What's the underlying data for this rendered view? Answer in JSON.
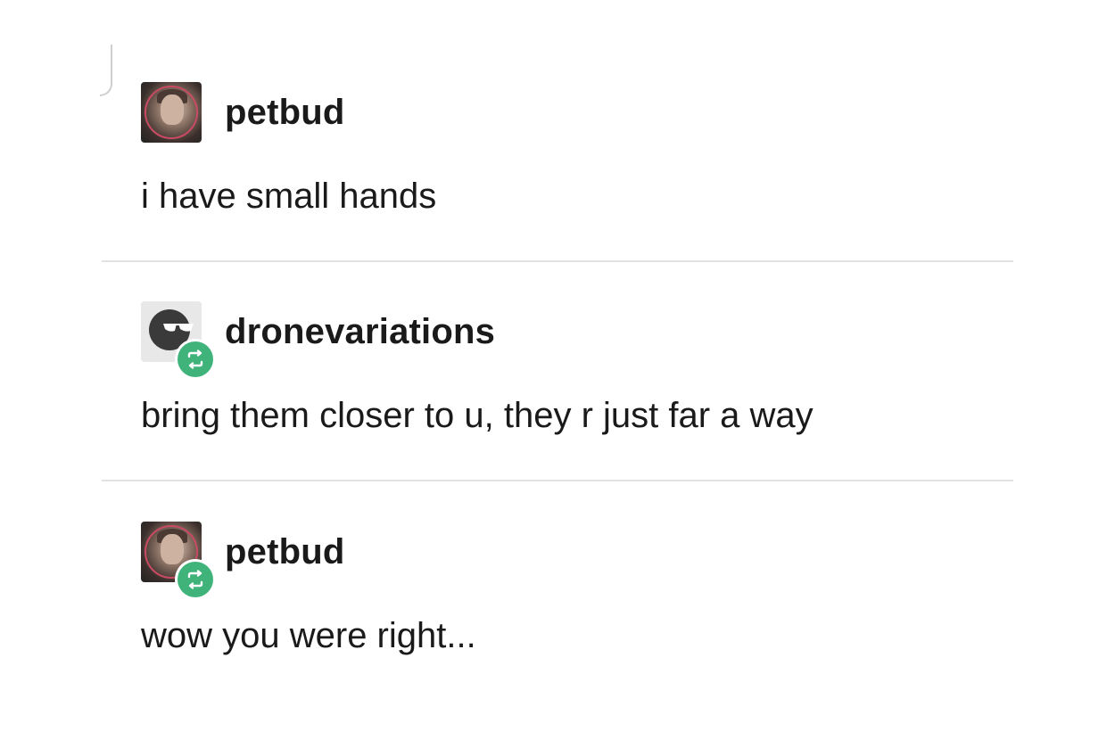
{
  "thread": {
    "posts": [
      {
        "username": "petbud",
        "avatar": "petbud-avatar",
        "reblog": false,
        "text": "i have small hands"
      },
      {
        "username": "dronevariations",
        "avatar": "dronevariations-avatar",
        "reblog": true,
        "text": "bring them closer to u, they r just far a way"
      },
      {
        "username": "petbud",
        "avatar": "petbud-avatar",
        "reblog": true,
        "text": "wow you were right..."
      }
    ]
  },
  "colors": {
    "reblog_badge": "#3fb37a",
    "divider": "#e2e2e2",
    "text": "#1a1a1a"
  },
  "icons": {
    "reblog": "reblog-icon"
  }
}
